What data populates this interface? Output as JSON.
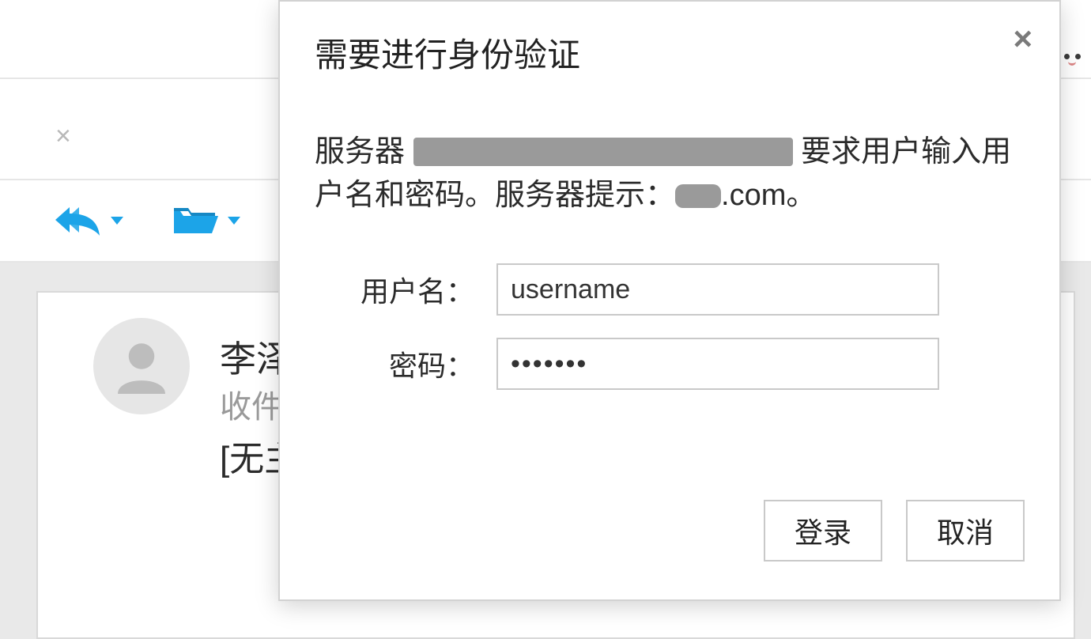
{
  "background": {
    "sender_name": "李泽",
    "recipients_label": "收件",
    "subject": "[无主",
    "tab_close_glyph": "×"
  },
  "toolbar": {
    "reply_icon_name": "reply-all-icon",
    "folder_icon_name": "folder-open-icon"
  },
  "dialog": {
    "title": "需要进行身份验证",
    "desc_prefix": "服务器 ",
    "desc_mid": " 要求用户输入用户名和密码。服务器提示：",
    "desc_domain_suffix": ".com。",
    "username_label": "用户名：",
    "password_label": "密码：",
    "username_value": "username",
    "password_value": "*******",
    "login_label": "登录",
    "cancel_label": "取消",
    "close_glyph": "×"
  },
  "colors": {
    "accent": "#1ca4e8"
  }
}
